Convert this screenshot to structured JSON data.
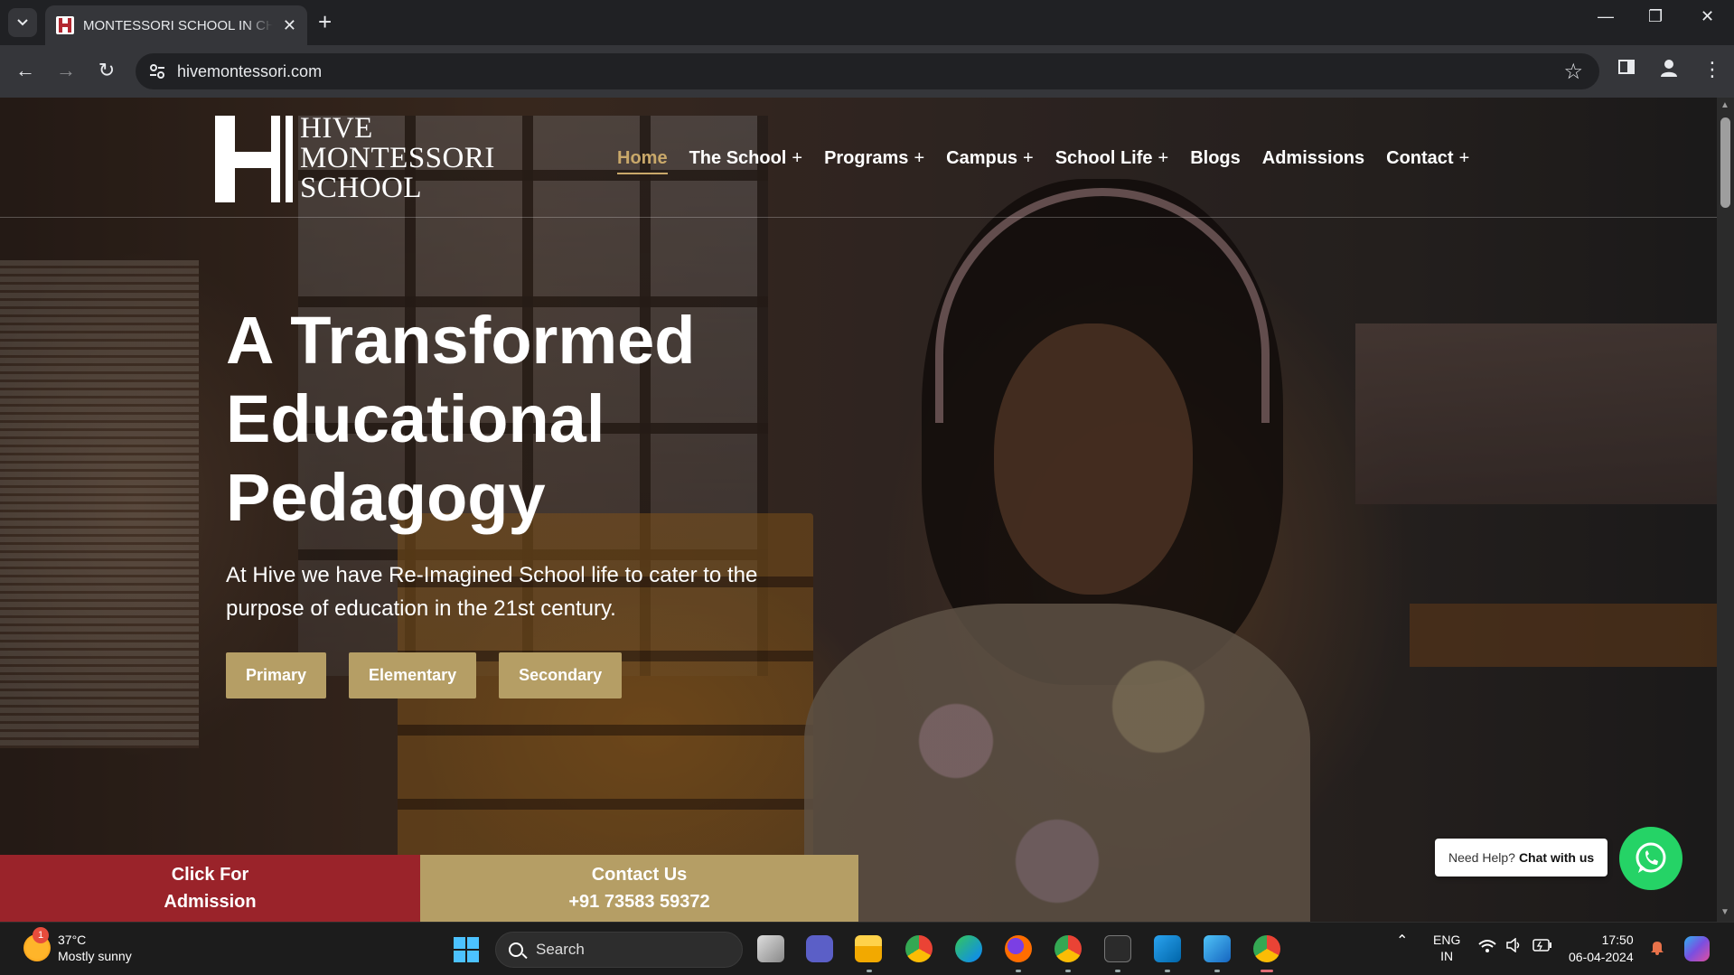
{
  "browser": {
    "tab_title": "MONTESSORI SCHOOL IN CHE",
    "url": "hivemontessori.com"
  },
  "site": {
    "logo_lines": [
      "HIVE",
      "MONTESSORI",
      "SCHOOL"
    ],
    "nav": [
      {
        "label": "Home",
        "has_submenu": false,
        "active": true
      },
      {
        "label": "The School",
        "has_submenu": true
      },
      {
        "label": "Programs",
        "has_submenu": true
      },
      {
        "label": "Campus",
        "has_submenu": true
      },
      {
        "label": "School Life",
        "has_submenu": true
      },
      {
        "label": "Blogs",
        "has_submenu": false
      },
      {
        "label": "Admissions",
        "has_submenu": false
      },
      {
        "label": "Contact",
        "has_submenu": true
      }
    ],
    "hero": {
      "title_lines": [
        "A Transformed",
        "Educational",
        "Pedagogy"
      ],
      "subtitle": "At Hive we have Re-Imagined School life to cater to the purpose of education in the 21st century.",
      "buttons": [
        "Primary",
        "Elementary",
        "Secondary"
      ]
    },
    "cta_admission": [
      "Click For",
      "Admission"
    ],
    "cta_contact": [
      "Contact Us",
      "+91 73583 59372"
    ],
    "help": {
      "prefix": "Need Help?",
      "action": "Chat with us"
    },
    "accent_color": "#b59e65",
    "admission_color": "#9a232a"
  },
  "taskbar": {
    "weather_badge": "1",
    "temperature": "37°C",
    "condition": "Mostly sunny",
    "search_placeholder": "Search",
    "lang_top": "ENG",
    "lang_bottom": "IN",
    "time": "17:50",
    "date": "06-04-2024"
  }
}
